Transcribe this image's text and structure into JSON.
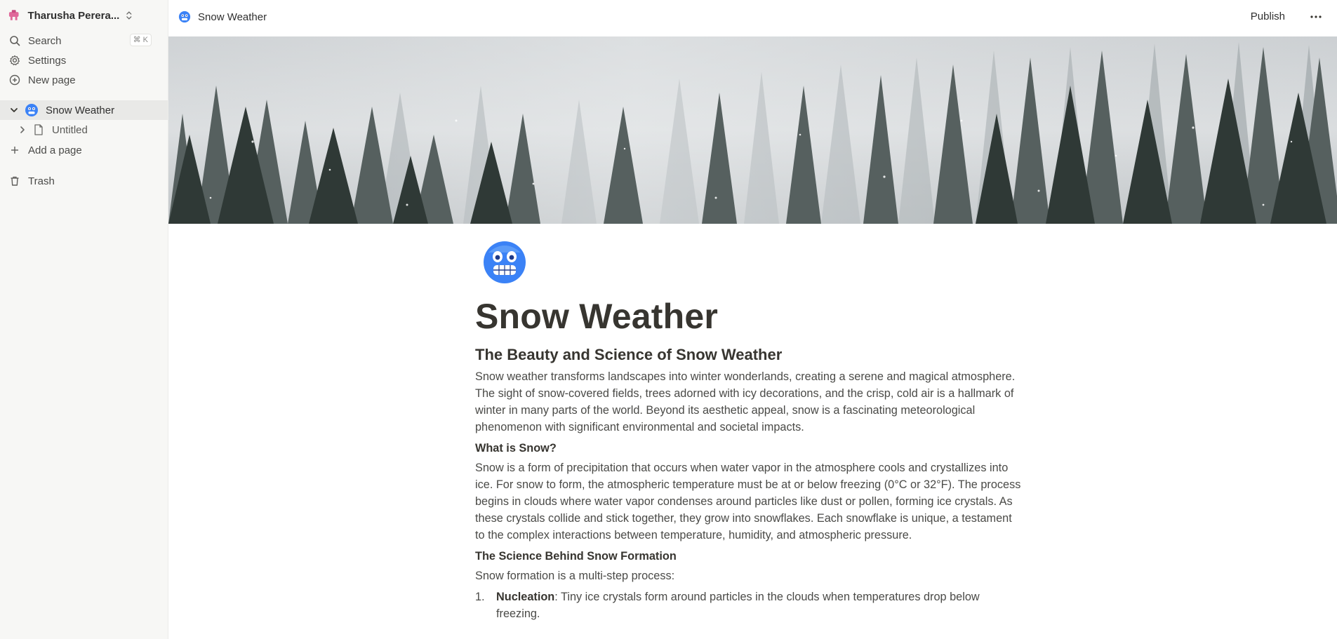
{
  "workspace": {
    "name": "Tharusha Perera..."
  },
  "sidebar": {
    "search_label": "Search",
    "search_shortcut": "⌘ K",
    "settings_label": "Settings",
    "new_page_label": "New page",
    "pages": [
      {
        "label": "Snow Weather",
        "icon": "freezing-face-icon",
        "expanded": true,
        "active": true
      },
      {
        "label": "Untitled",
        "icon": "document-icon",
        "expanded": false,
        "active": false
      }
    ],
    "add_page_label": "Add a page",
    "trash_label": "Trash"
  },
  "topbar": {
    "breadcrumb": "Snow Weather",
    "publish_label": "Publish"
  },
  "page": {
    "title": "Snow Weather",
    "heading": "The Beauty and Science of Snow Weather",
    "intro": "Snow weather transforms landscapes into winter wonderlands, creating a serene and magical atmosphere. The sight of snow-covered fields, trees adorned with icy decorations, and the crisp, cold air is a hallmark of winter in many parts of the world. Beyond its aesthetic appeal, snow is a fascinating meteorological phenomenon with significant environmental and societal impacts.",
    "what_heading": "What is Snow?",
    "what_body": "Snow is a form of precipitation that occurs when water vapor in the atmosphere cools and crystallizes into ice. For snow to form, the atmospheric temperature must be at or below freezing (0°C or 32°F). The process begins in clouds where water vapor condenses around particles like dust or pollen, forming ice crystals. As these crystals collide and stick together, they grow into snowflakes. Each snowflake is unique, a testament to the complex interactions between temperature, humidity, and atmospheric pressure.",
    "science_heading": "The Science Behind Snow Formation",
    "science_intro": "Snow formation is a multi-step process:",
    "list": [
      {
        "num": "1.",
        "term": "Nucleation",
        "text": ": Tiny ice crystals form around particles in the clouds when temperatures drop below freezing."
      }
    ]
  },
  "colors": {
    "sidebar_bg": "#f7f7f5",
    "active_row": "#e9e9e7",
    "text": "#37352f",
    "emoji_blue": "#3b82f6"
  }
}
